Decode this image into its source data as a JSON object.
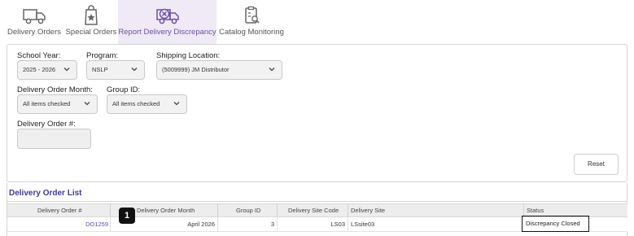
{
  "nav": {
    "items": [
      {
        "label": "Delivery Orders",
        "icon": "truck-icon"
      },
      {
        "label": "Special Orders",
        "icon": "special-bag-icon"
      },
      {
        "label": "Report Delivery Discrepancy",
        "icon": "truck-discrepancy-icon"
      },
      {
        "label": "Catalog Monitoring",
        "icon": "clipboard-search-icon"
      }
    ],
    "active_index": 2
  },
  "filters": {
    "school_year": {
      "label": "School Year:",
      "value": "2025 - 2026"
    },
    "program": {
      "label": "Program:",
      "value": "NSLP"
    },
    "shipping_location": {
      "label": "Shipping Location:",
      "value": "(5009999) JM Distributor"
    },
    "delivery_order_month": {
      "label": "Delivery Order Month:",
      "value": "All items checked"
    },
    "group_id": {
      "label": "Group ID:",
      "value": "All items checked"
    },
    "delivery_order_number": {
      "label": "Delivery Order #:",
      "value": ""
    },
    "reset_label": "Reset"
  },
  "delivery_order_list": {
    "title": "Delivery Order List",
    "columns": [
      "Delivery Order #",
      "Delivery Order Month",
      "Group ID",
      "Delivery Site Code",
      "Delivery Site",
      "Status"
    ],
    "rows": [
      {
        "order_number": "DO1259",
        "month": "April 2026",
        "group_id": "3",
        "site_code": "LS03",
        "site": "LSsite03",
        "status": "Discrepancy Closed"
      }
    ]
  },
  "step_badge": "1",
  "colors": {
    "accent": "#6c4fa3",
    "active_tab_bg": "#efeaf6",
    "list_title": "#3b3b98",
    "link": "#5b4aa8"
  }
}
